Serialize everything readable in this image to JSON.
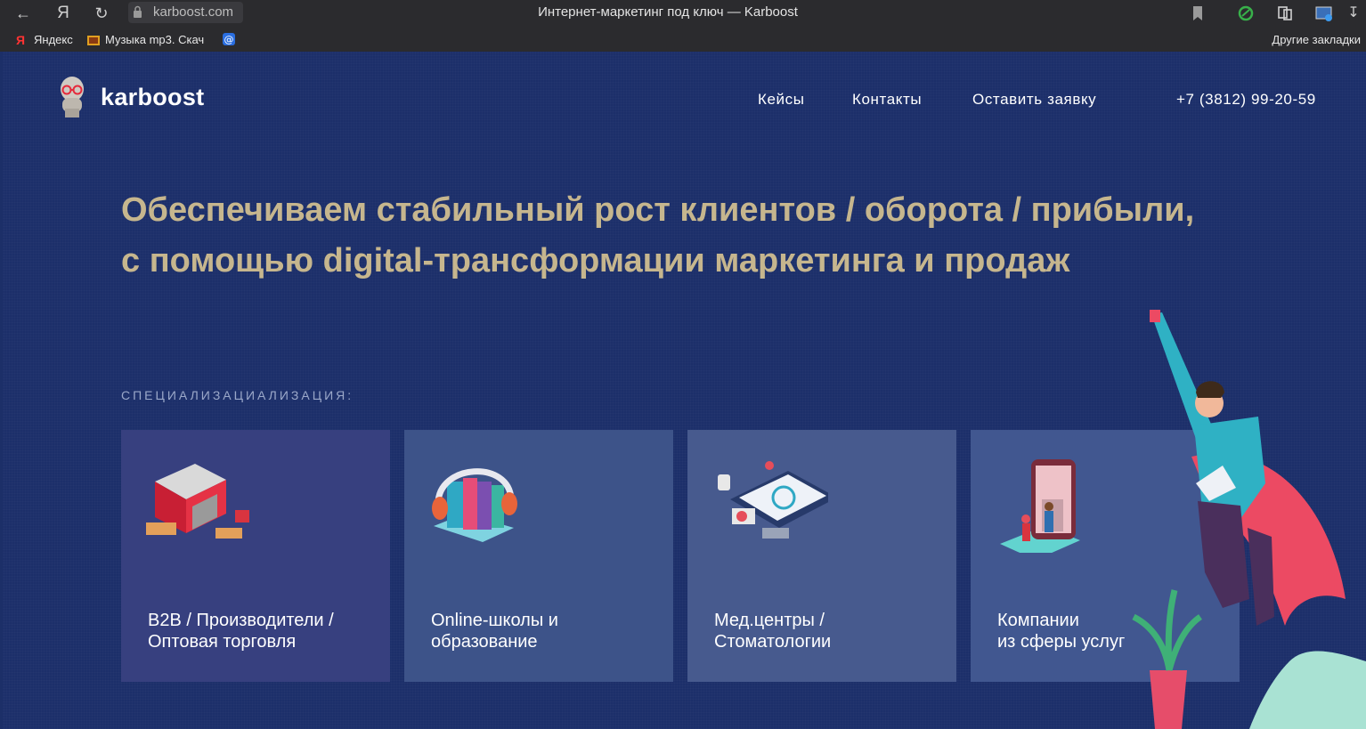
{
  "browser": {
    "url": "karboost.com",
    "window_title": "Интернет-маркетинг под ключ — Karboost",
    "bookmarks": [
      {
        "label": "Яндекс",
        "icon": "yandex-icon"
      },
      {
        "label": "Музыка mp3. Скач",
        "icon": "music-icon"
      },
      {
        "label": "",
        "icon": "at-icon"
      }
    ],
    "other_bookmarks": "Другие закладки"
  },
  "site": {
    "logo_text": "karboost",
    "nav": [
      {
        "label": "Кейсы"
      },
      {
        "label": "Контакты"
      },
      {
        "label": "Оставить заявку"
      }
    ],
    "phone": "+7 (3812) 99-20-59",
    "headline_1": "Обеспечиваем стабильный рост клиентов / оборота / прибыли,",
    "headline_2": "с помощью digital-трансформации маркетинга и продаж",
    "spec_label": "СПЕЦИАЛИЗАЦИАЛИЗАЦИЯ:",
    "cards": [
      {
        "title": "B2B / Производители /\nОптовая торговля",
        "color": "#37407f"
      },
      {
        "title": "Online-школы и\nобразование",
        "color": "#3d5389"
      },
      {
        "title": "Мед.центры /\nСтоматологии",
        "color": "#475a8e"
      },
      {
        "title": "Компании\nиз сферы услуг",
        "color": "#415790"
      }
    ]
  },
  "colors": {
    "page_bg": "#1c2f6a",
    "headline": "#c6b68e",
    "chrome": "#2b2b2e"
  }
}
